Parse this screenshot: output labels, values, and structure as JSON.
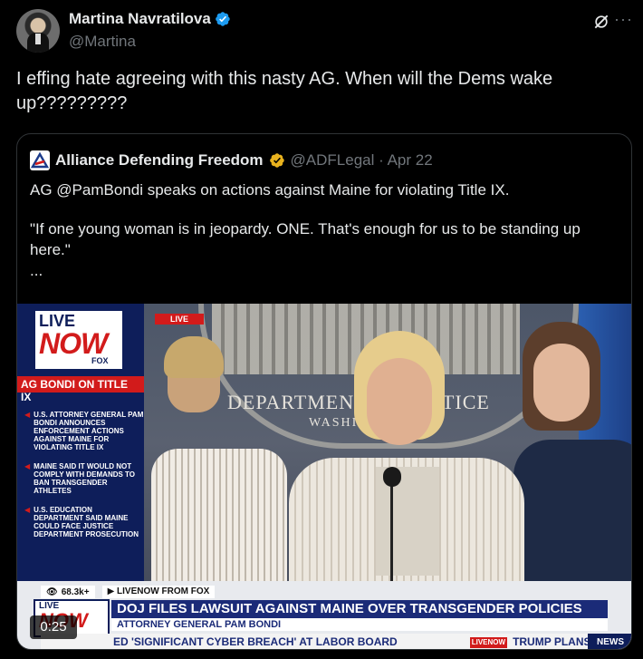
{
  "author": {
    "display_name": "Martina Navratilova",
    "handle": "@Martina",
    "verified_color": "#1d9bf0"
  },
  "tweet": {
    "text": "I effing hate agreeing with this nasty AG. When will the Dems wake up?????????"
  },
  "quoted": {
    "display_name": "Alliance Defending Freedom",
    "handle_date": "@ADFLegal · Apr 22",
    "verified_color": "#e8b21e",
    "line1": "AG @PamBondi speaks on actions against Maine for violating Title IX.",
    "line2": "\"If one young woman is in jeopardy. ONE. That's enough for us to be standing up here.\"",
    "line3": "..."
  },
  "video": {
    "timer": "0:25",
    "live_label": "LIVE",
    "now_label": "NOW",
    "fox_label": "FOX",
    "live_pill": "LIVE",
    "sidebar_title": "AG BONDI ON TITLE IX",
    "bullets": [
      "U.S. Attorney General Pam Bondi announces enforcement actions against Maine for violating Title IX",
      "Maine said it would not comply with demands to ban transgender athletes",
      "U.S. Education Department said Maine could face Justice Department prosecution"
    ],
    "backdrop_title": "DEPARTMENT OF JUSTICE",
    "backdrop_sub": "WASHI",
    "views": "68.3k+",
    "from_fox": "▶ LIVENOW FROM FOX",
    "headline": "DOJ FILES LAWSUIT AGAINST MAINE OVER TRANSGENDER POLICIES",
    "subhead": "ATTORNEY GENERAL PAM BONDI",
    "ticker_left": "ED 'SIGNIFICANT CYBER BREACH' AT LABOR BOARD",
    "ticker_logo": "LIVENOW",
    "ticker_right": "TRUMP PLANS ORDI",
    "news_tag": "NEWS"
  }
}
